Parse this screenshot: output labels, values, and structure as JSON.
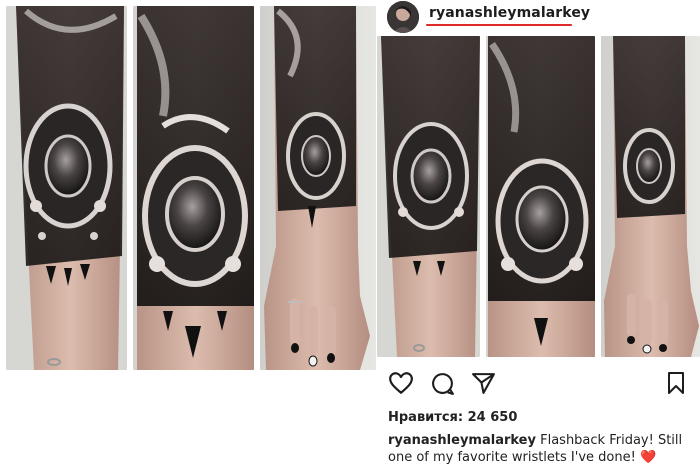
{
  "post": {
    "username": "ryanashleymalarkey",
    "likes_text": "Нравится: 24 650",
    "caption_user": "ryanashleymalarkey",
    "caption_text": " Flashback Friday! Still one of my favorite wristlets I've done! ",
    "caption_emoji": "❤️"
  },
  "icons": {
    "like": "heart-outline-icon",
    "comment": "comment-bubble-icon",
    "share": "paper-plane-icon",
    "save": "bookmark-icon"
  },
  "colors": {
    "highlight_underline": "#e02a2a",
    "text": "#222222"
  },
  "photos": [
    {
      "name": "tattoo-photo-1"
    },
    {
      "name": "tattoo-photo-2"
    },
    {
      "name": "tattoo-photo-3"
    },
    {
      "name": "tattoo-photo-4"
    },
    {
      "name": "tattoo-photo-5"
    },
    {
      "name": "tattoo-photo-6"
    }
  ]
}
